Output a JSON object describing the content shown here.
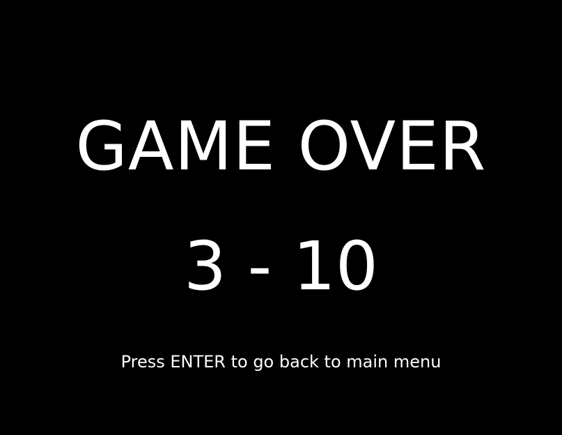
{
  "game_over": {
    "title": "GAME OVER",
    "score": "3 - 10",
    "hint": "Press ENTER to go back to main menu"
  },
  "colors": {
    "background": "#000000",
    "text": "#ffffff"
  }
}
